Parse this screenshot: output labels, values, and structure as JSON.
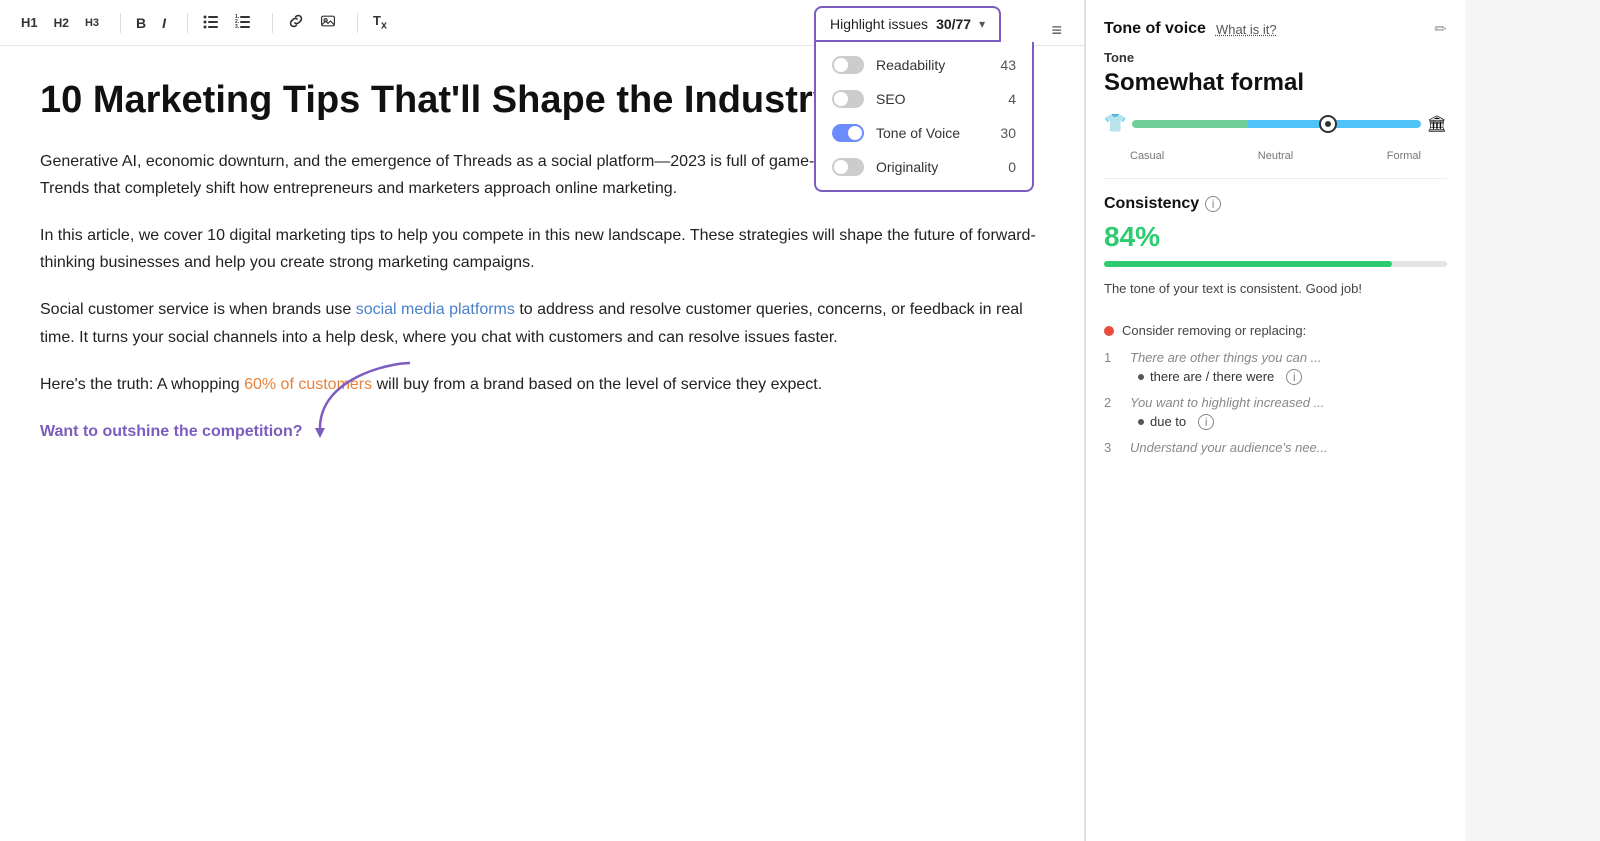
{
  "toolbar": {
    "h1": "H1",
    "h2": "H2",
    "h3": "H3",
    "bold": "B",
    "italic": "I",
    "bullet_list": "☰",
    "numbered_list": "≡",
    "link": "🔗",
    "image": "🖼",
    "clear": "Tx",
    "highlight_label": "Highlight issues",
    "highlight_count": "30/77",
    "menu_icon": "≡"
  },
  "dropdown": {
    "items": [
      {
        "label": "Readability",
        "count": "43",
        "on": false
      },
      {
        "label": "SEO",
        "count": "4",
        "on": false
      },
      {
        "label": "Tone of Voice",
        "count": "30",
        "on": true
      },
      {
        "label": "Originality",
        "count": "0",
        "on": false
      }
    ]
  },
  "editor": {
    "title": "10 Marketing Tips That'll Shape the Industry",
    "paragraphs": [
      "Generative AI, economic downturn, and the emergence of Threads as a social platform—2023 is full of game-changing marketing trends. Trends that completely shift how entrepreneurs and marketers approach online marketing.",
      "In this article, we cover 10 digital marketing tips to help you compete in this new landscape. These strategies will shape the future of forward-thinking businesses and help you create strong marketing campaigns.",
      "Social customer service is when brands use {social media platforms} to address and resolve customer queries, concerns, or feedback in real time. It turns your social channels into a help desk, where you chat with customers and can resolve issues faster.",
      "Here's the truth: A whopping {60% of customers} will buy from a brand based on the level of service they expect.",
      "Want to outshine the competition?"
    ],
    "link_text": "social media platforms",
    "orange_link_text": "60% of customers",
    "highlighted_cta": "Want to outshine the competition?"
  },
  "right_panel": {
    "tone_section": {
      "title": "Tone of voice",
      "what_is_it": "What is it?",
      "tone_label": "Tone",
      "tone_value": "Somewhat formal",
      "scale_labels": [
        "Casual",
        "Neutral",
        "Formal"
      ],
      "casual_icon": "👕",
      "formal_icon": "🏛"
    },
    "consistency_section": {
      "title": "Consistency",
      "value": "84%",
      "bar_width": "84",
      "description": "The tone of your text is consistent. Good job!"
    },
    "issues": {
      "remove_label": "Consider removing or replacing:",
      "items": [
        {
          "num": "1",
          "quote": "There are other things you can ...",
          "sub_label": "there are / there were",
          "has_info": true
        },
        {
          "num": "2",
          "quote": "You want to highlight increased ...",
          "sub_label": "due to",
          "has_info": true
        },
        {
          "num": "3",
          "quote": "Understand your audience's nee...",
          "sub_label": "",
          "has_info": false
        }
      ]
    }
  }
}
